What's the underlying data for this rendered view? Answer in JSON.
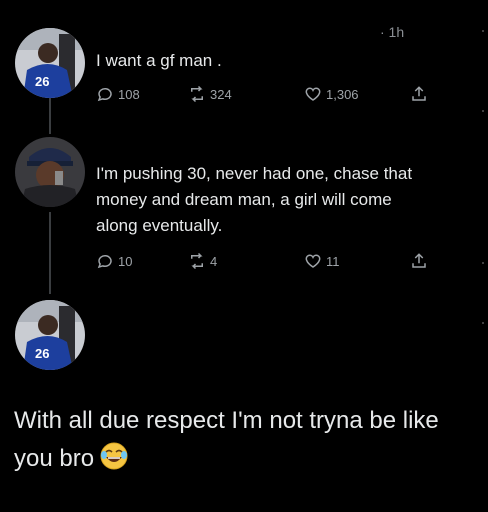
{
  "tweet1": {
    "time": "· 1h",
    "text": "I want a gf man .",
    "replies": "108",
    "retweets": "324",
    "likes": "1,306"
  },
  "tweet2": {
    "lines": [
      "I'm pushing 30, never had one, chase that",
      "money and dream man, a girl will come",
      "along eventually."
    ],
    "replies": "10",
    "retweets": "4",
    "likes": "11"
  },
  "reply": {
    "text": "With all due respect I'm not tryna be like you bro",
    "emoji_icon": "laughing-crying-face-emoji"
  },
  "colors": {
    "background": "#000000",
    "text": "#e7e9ea",
    "muted": "#9ea3a8",
    "jersey": "#1d3f9e"
  }
}
